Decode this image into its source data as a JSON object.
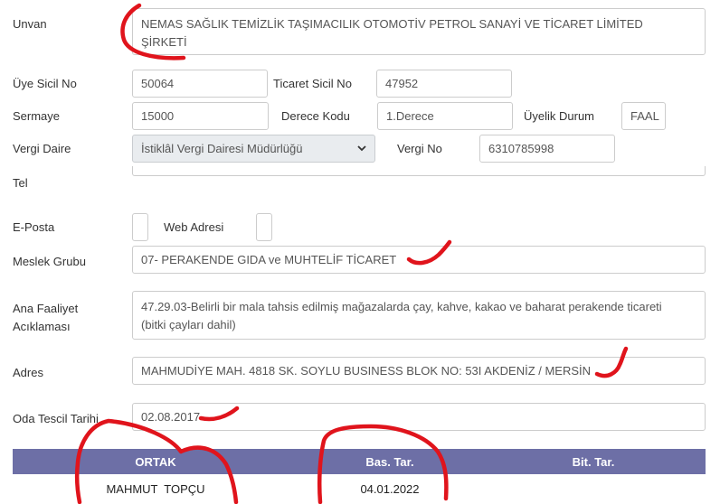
{
  "labels": {
    "unvan": "Unvan",
    "uye_sicil_no": "Üye Sicil No",
    "ticaret_sicil_no": "Ticaret Sicil No",
    "sermaye": "Sermaye",
    "derece_kodu": "Derece Kodu",
    "uyelik_durum": "Üyelik Durum",
    "vergi_daire": "Vergi Daire",
    "vergi_no": "Vergi No",
    "tel": "Tel",
    "e_posta": "E-Posta",
    "web_adresi": "Web Adresi",
    "meslek_grubu": "Meslek Grubu",
    "ana_faaliyet_line1": "Ana Faaliyet",
    "ana_faaliyet_line2": "Acıklaması",
    "adres": "Adres",
    "oda_tescil_tarihi": "Oda Tescil Tarihi"
  },
  "values": {
    "unvan_line1": "NEMAS SAĞLIK TEMİZLİK TAŞIMACILIK OTOMOTİV PETROL SANAYİ VE TİCARET LİMİTED",
    "unvan_line2": "ŞİRKETİ",
    "uye_sicil_no": "50064",
    "ticaret_sicil_no": "47952",
    "sermaye": "15000",
    "derece_kodu": "1.Derece",
    "uyelik_durum": "FAAL",
    "vergi_daire": "İstiklâl Vergi Dairesi Müdürlüğü",
    "vergi_no": "6310785998",
    "tel": "",
    "e_posta": "",
    "web_adresi": "",
    "meslek_grubu": "07- PERAKENDE GIDA ve MUHTELİF TİCARET",
    "ana_faaliyet_line1": "47.29.03-Belirli bir mala tahsis edilmiş mağazalarda çay, kahve, kakao ve baharat perakende ticareti",
    "ana_faaliyet_line2": "(bitki çayları dahil)",
    "adres": "MAHMUDİYE MAH. 4818 SK. SOYLU BUSINESS BLOK NO: 53I AKDENİZ / MERSİN",
    "oda_tescil_tarihi": "02.08.2017"
  },
  "partners_table": {
    "headers": [
      "ORTAK",
      "Bas. Tar.",
      "Bit. Tar."
    ],
    "rows": [
      [
        "MAHMUT  TOPÇU",
        "04.01.2022",
        ""
      ]
    ]
  },
  "colors": {
    "table_header_bg": "#6d6fa6",
    "annotation_red": "#e0141c",
    "select_bg": "#e9ecef"
  },
  "icons": {
    "select_arrow": "chevron-down-icon"
  }
}
